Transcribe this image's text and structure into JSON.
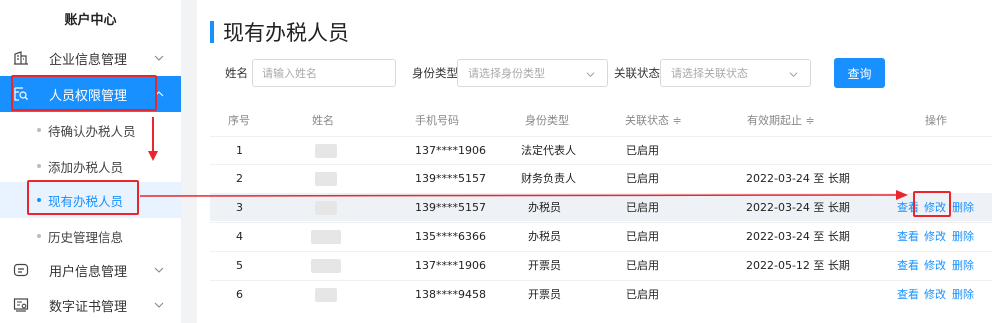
{
  "sidebar": {
    "title": "账户中心",
    "menus": [
      {
        "label": "企业信息管理",
        "icon": "building-icon"
      },
      {
        "label": "人员权限管理",
        "icon": "user-search-icon"
      },
      {
        "label": "用户信息管理",
        "icon": "id-card-icon"
      },
      {
        "label": "数字证书管理",
        "icon": "certificate-icon"
      }
    ],
    "subitems": [
      {
        "label": "待确认办税人员"
      },
      {
        "label": "添加办税人员"
      },
      {
        "label": "现有办税人员"
      },
      {
        "label": "历史管理信息"
      }
    ]
  },
  "page": {
    "title": "现有办税人员"
  },
  "filters": {
    "name_label": "姓名",
    "name_placeholder": "请输入姓名",
    "type_label": "身份类型",
    "type_placeholder": "请选择身份类型",
    "status_label": "关联状态",
    "status_placeholder": "请选择关联状态",
    "query_label": "查询"
  },
  "table": {
    "headers": {
      "index": "序号",
      "name": "姓名",
      "phone": "手机号码",
      "type": "身份类型",
      "status": "关联状态 ≑",
      "period": "有效期起止 ≑",
      "actions": "操作"
    },
    "rows": [
      {
        "index": "1",
        "phone": "137****1906",
        "type": "法定代表人",
        "status": "已启用",
        "period": "",
        "view": "",
        "edit": "",
        "delete": ""
      },
      {
        "index": "2",
        "phone": "139****5157",
        "type": "财务负责人",
        "status": "已启用",
        "period": "2022-03-24 至 长期",
        "view": "",
        "edit": "",
        "delete": ""
      },
      {
        "index": "3",
        "phone": "139****5157",
        "type": "办税员",
        "status": "已启用",
        "period": "2022-03-24 至 长期",
        "view": "查看",
        "edit": "修改",
        "delete": "删除"
      },
      {
        "index": "4",
        "phone": "135****6366",
        "type": "办税员",
        "status": "已启用",
        "period": "2022-03-24 至 长期",
        "view": "查看",
        "edit": "修改",
        "delete": "删除"
      },
      {
        "index": "5",
        "phone": "137****1906",
        "type": "开票员",
        "status": "已启用",
        "period": "2022-05-12 至 长期",
        "view": "查看",
        "edit": "修改",
        "delete": "删除"
      },
      {
        "index": "6",
        "phone": "138****9458",
        "type": "开票员",
        "status": "已启用",
        "period": "",
        "view": "查看",
        "edit": "修改",
        "delete": "删除"
      }
    ]
  },
  "colors": {
    "accent": "#1890ff",
    "annotation": "#e8262c",
    "highlight_row": "#eef1f5"
  }
}
